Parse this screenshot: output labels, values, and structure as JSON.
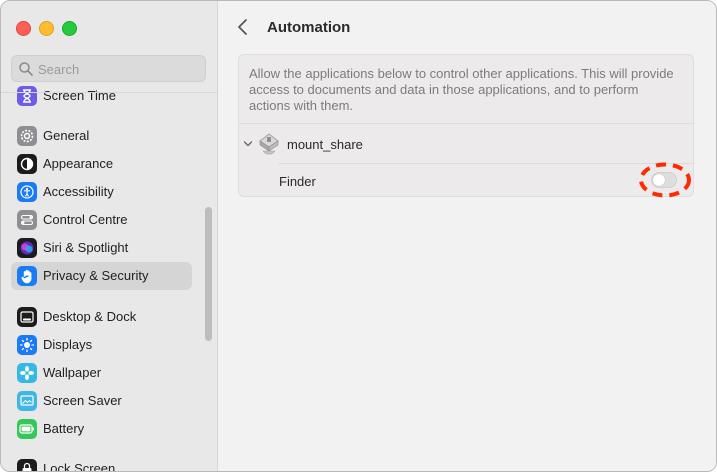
{
  "window": {
    "traffic_lights": [
      "close",
      "minimize",
      "zoom"
    ]
  },
  "sidebar": {
    "search": {
      "placeholder": "Search",
      "value": ""
    },
    "items": [
      {
        "label": "Screen Time",
        "icon": "hourglass-icon",
        "color": "#6c5ce7"
      },
      {
        "label": "General",
        "icon": "gear-icon",
        "color": "#8e8e93"
      },
      {
        "label": "Appearance",
        "icon": "appearance-icon",
        "color": "#1c1c1e"
      },
      {
        "label": "Accessibility",
        "icon": "accessibility-icon",
        "color": "#1a7cf5"
      },
      {
        "label": "Control Centre",
        "icon": "control-centre-icon",
        "color": "#8e8e93"
      },
      {
        "label": "Siri & Spotlight",
        "icon": "siri-icon",
        "color": "#7b3fe4"
      },
      {
        "label": "Privacy & Security",
        "icon": "hand-icon",
        "color": "#1a7cf5",
        "selected": true
      },
      {
        "label": "Desktop & Dock",
        "icon": "dock-icon",
        "color": "#1c1c1e"
      },
      {
        "label": "Displays",
        "icon": "sun-icon",
        "color": "#1a7cf5"
      },
      {
        "label": "Wallpaper",
        "icon": "flower-icon",
        "color": "#35b7e9"
      },
      {
        "label": "Screen Saver",
        "icon": "screensaver-icon",
        "color": "#3eb6e6"
      },
      {
        "label": "Battery",
        "icon": "battery-icon",
        "color": "#34c759"
      },
      {
        "label": "Lock Screen",
        "icon": "lock-icon",
        "color": "#1c1c1e"
      }
    ]
  },
  "main": {
    "title": "Automation",
    "description": "Allow the applications below to control other applications. This will provide access to documents and data in those applications, and to perform actions with them.",
    "apps": [
      {
        "name": "mount_share",
        "icon": "disk-icon",
        "expanded": true,
        "targets": [
          {
            "name": "Finder",
            "enabled": false
          }
        ]
      }
    ]
  },
  "colors": {
    "highlight": "#ff2a00",
    "selected_bg": "#d6d5d5"
  }
}
